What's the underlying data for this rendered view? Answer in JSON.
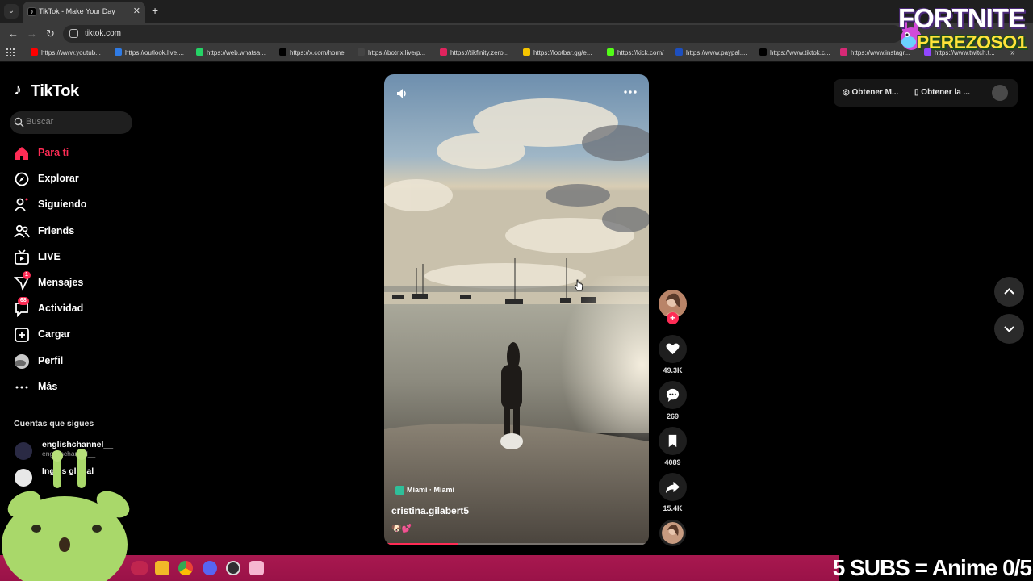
{
  "browser": {
    "tab_title": "TikTok - Make Your Day",
    "tab_close": "✕",
    "new_tab": "+",
    "url": "tiktok.com",
    "bookmarks": [
      {
        "label": "https://www.youtub...",
        "color": "#ff0000"
      },
      {
        "label": "https://outlook.live....",
        "color": "#2f7be5"
      },
      {
        "label": "https://web.whatsa...",
        "color": "#25d366"
      },
      {
        "label": "https://x.com/home",
        "color": "#000000"
      },
      {
        "label": "https://botrix.live/p...",
        "color": "#444444"
      },
      {
        "label": "https://tikfinity.zero...",
        "color": "#e0245e"
      },
      {
        "label": "https://lootbar.gg/e...",
        "color": "#f5c400"
      },
      {
        "label": "https://kick.com/",
        "color": "#53fc18"
      },
      {
        "label": "https://www.paypal....",
        "color": "#1d4fbf"
      },
      {
        "label": "https://www.tiktok.c...",
        "color": "#000000"
      },
      {
        "label": "https://www.instagr...",
        "color": "#d62976"
      },
      {
        "label": "https://www.twitch.t...",
        "color": "#9146ff"
      }
    ],
    "bookmarks_more": "»"
  },
  "overlay": {
    "fortnite_title": "FORTNITE",
    "fortnite_name": "PEREZOSO1",
    "subs_banner": "5 SUBS = Anime 0/5"
  },
  "tiktok": {
    "logo_text": "TikTok",
    "search_placeholder": "Buscar",
    "nav": [
      {
        "label": "Para ti",
        "icon": "home-icon",
        "active": true
      },
      {
        "label": "Explorar",
        "icon": "compass-icon"
      },
      {
        "label": "Siguiendo",
        "icon": "following-icon"
      },
      {
        "label": "Friends",
        "icon": "friends-icon"
      },
      {
        "label": "LIVE",
        "icon": "live-icon"
      },
      {
        "label": "Mensajes",
        "icon": "messages-icon",
        "badge": "1"
      },
      {
        "label": "Actividad",
        "icon": "activity-icon",
        "badge": "68"
      },
      {
        "label": "Cargar",
        "icon": "upload-icon"
      },
      {
        "label": "Perfil",
        "icon": "profile-icon"
      },
      {
        "label": "Más",
        "icon": "more-icon"
      }
    ],
    "following_heading": "Cuentas que sigues",
    "following": [
      {
        "name": "englishchannel__",
        "user": "englishchannel__"
      },
      {
        "name": "Inglés global",
        "user": ""
      }
    ],
    "video": {
      "location": "Miami · Miami",
      "author": "cristina.gilabert5",
      "emojis": "🐶💕",
      "progress": 0.28
    },
    "actions": {
      "likes": "49.3K",
      "comments": "269",
      "saves": "4089",
      "shares": "15.4K"
    },
    "top_right": {
      "get_coins": "Obtener M...",
      "get_app": "Obtener la ..."
    }
  },
  "colors": {
    "accent": "#fe2c55",
    "taskbar": "#a8184f"
  }
}
